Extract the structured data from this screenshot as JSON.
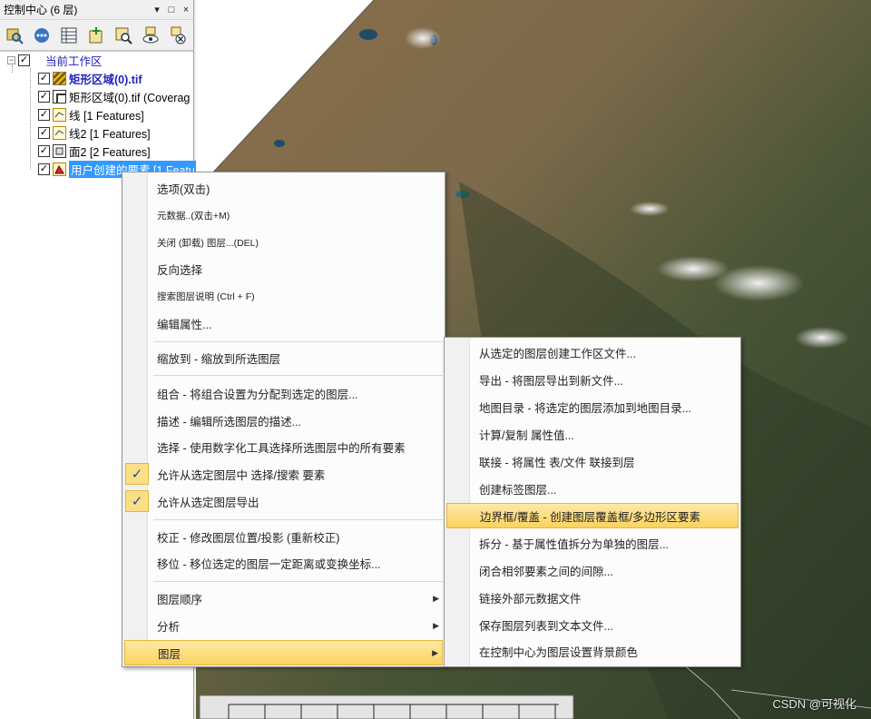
{
  "panel": {
    "title": "控制中心 (6 层)",
    "controls": [
      "▾",
      "□",
      "×"
    ],
    "toolbar_icons": [
      "layer-search-icon",
      "options-icon",
      "attribute-table-icon",
      "add-layer-icon",
      "layer-zoom-icon",
      "show-layers-icon",
      "close-layers-icon"
    ],
    "tree": {
      "root_label": "当前工作区",
      "layers": [
        {
          "label": "矩形区域(0).tif",
          "icon": "raster-icon",
          "style": "blue-bold"
        },
        {
          "label": "矩形区域(0).tif (Coverag",
          "icon": "coverage-icon",
          "style": "normal"
        },
        {
          "label": "线 [1 Features]",
          "icon": "line-layer-icon",
          "style": "normal"
        },
        {
          "label": "线2 [1 Features]",
          "icon": "line-layer-icon",
          "style": "normal"
        },
        {
          "label": "面2 [2 Features]",
          "icon": "polygon-layer-icon",
          "style": "normal"
        },
        {
          "label": "用户创建的要素 [1 Featu",
          "icon": "feature-layer-icon",
          "style": "selected"
        }
      ]
    }
  },
  "context_menu": {
    "items": [
      {
        "label": "选项(双击)"
      },
      {
        "label": "元数据..(双击+M)"
      },
      {
        "label": "关闭 (卸载) 图层...(DEL)"
      },
      {
        "label": "反向选择"
      },
      {
        "label": "搜索图层说明 (Ctrl + F)"
      },
      {
        "label": "编辑属性..."
      },
      {
        "label": "缩放到 - 缩放到所选图层"
      },
      {
        "label": "组合 - 将组合设置为分配到选定的图层..."
      },
      {
        "label": "描述 - 编辑所选图层的描述..."
      },
      {
        "label": "选择 - 使用数字化工具选择所选图层中的所有要素"
      },
      {
        "label": "允许从选定图层中 选择/搜索 要素",
        "checked": "✓"
      },
      {
        "label": "允许从选定图层导出",
        "checked": "✓"
      },
      {
        "label": "校正 - 修改图层位置/投影 (重新校正)"
      },
      {
        "label": "移位 - 移位选定的图层一定距离或变换坐标..."
      },
      {
        "label": "图层顺序"
      },
      {
        "label": "分析"
      },
      {
        "label": "图层"
      }
    ]
  },
  "submenu": {
    "items": [
      "从选定的图层创建工作区文件...",
      "导出 - 将图层导出到新文件...",
      "地图目录 - 将选定的图层添加到地图目录...",
      "计算/复制 属性值...",
      "联接 - 将属性 表/文件 联接到层",
      "创建标签图层...",
      "边界框/覆盖 - 创建图层覆盖框/多边形区要素",
      "拆分 - 基于属性值拆分为单独的图层...",
      "闭合相邻要素之间的间隙...",
      "链接外部元数据文件",
      "保存图层列表到文本文件...",
      "在控制中心为图层设置背景颜色"
    ],
    "highlighted": "边界框/覆盖 - 创建图层覆盖框/多边形区要素"
  },
  "map": {
    "watermark": "CSDN @可视化"
  }
}
